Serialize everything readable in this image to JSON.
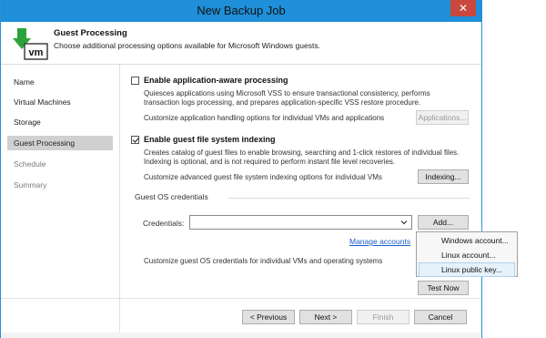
{
  "window": {
    "title": "New Backup Job",
    "close_glyph": "✕"
  },
  "header": {
    "icon": "vm-download-icon",
    "icon_text": "vm",
    "title": "Guest Processing",
    "subtitle": "Choose additional processing options available for Microsoft Windows guests."
  },
  "sidebar": {
    "items": [
      {
        "label": "Name",
        "state": "done"
      },
      {
        "label": "Virtual Machines",
        "state": "done"
      },
      {
        "label": "Storage",
        "state": "done"
      },
      {
        "label": "Guest Processing",
        "state": "active"
      },
      {
        "label": "Schedule",
        "state": "pending"
      },
      {
        "label": "Summary",
        "state": "pending"
      }
    ]
  },
  "app_aware": {
    "checked": false,
    "title": "Enable application-aware processing",
    "description_line1": "Quiesces applications using Microsoft VSS to ensure transactional consistency, performs",
    "description_line2": "transaction logs processing, and prepares application-specific VSS restore procedure.",
    "customize_text": "Customize application handling options for individual VMs and applications",
    "button_label": "Applications..."
  },
  "indexing": {
    "checked": true,
    "title": "Enable guest file system indexing",
    "description_line1": "Creates catalog of guest files to enable browsing, searching and 1-click restores of individual files.",
    "description_line2": "Indexing is optional, and is not required to perform instant file level recoveries.",
    "customize_text": "Customize advanced guest file system indexing options for individual VMs",
    "button_label": "Indexing..."
  },
  "credentials": {
    "section_label": "Guest OS credentials",
    "field_label": "Credentials:",
    "value": "",
    "add_button": "Add...",
    "manage_link": "Manage accounts",
    "customize_text": "Customize guest OS credentials for individual VMs and operating systems",
    "test_button": "Test Now"
  },
  "add_menu": {
    "items": [
      {
        "label": "Windows account..."
      },
      {
        "label": "Linux account..."
      },
      {
        "label": "Linux public key..."
      }
    ]
  },
  "footer": {
    "previous": "< Previous",
    "next": "Next >",
    "finish": "Finish",
    "cancel": "Cancel"
  },
  "colors": {
    "titlebar": "#1e8fd8",
    "close": "#c9473d",
    "link": "#1a5cc8",
    "active_nav": "#d0d0d0"
  }
}
